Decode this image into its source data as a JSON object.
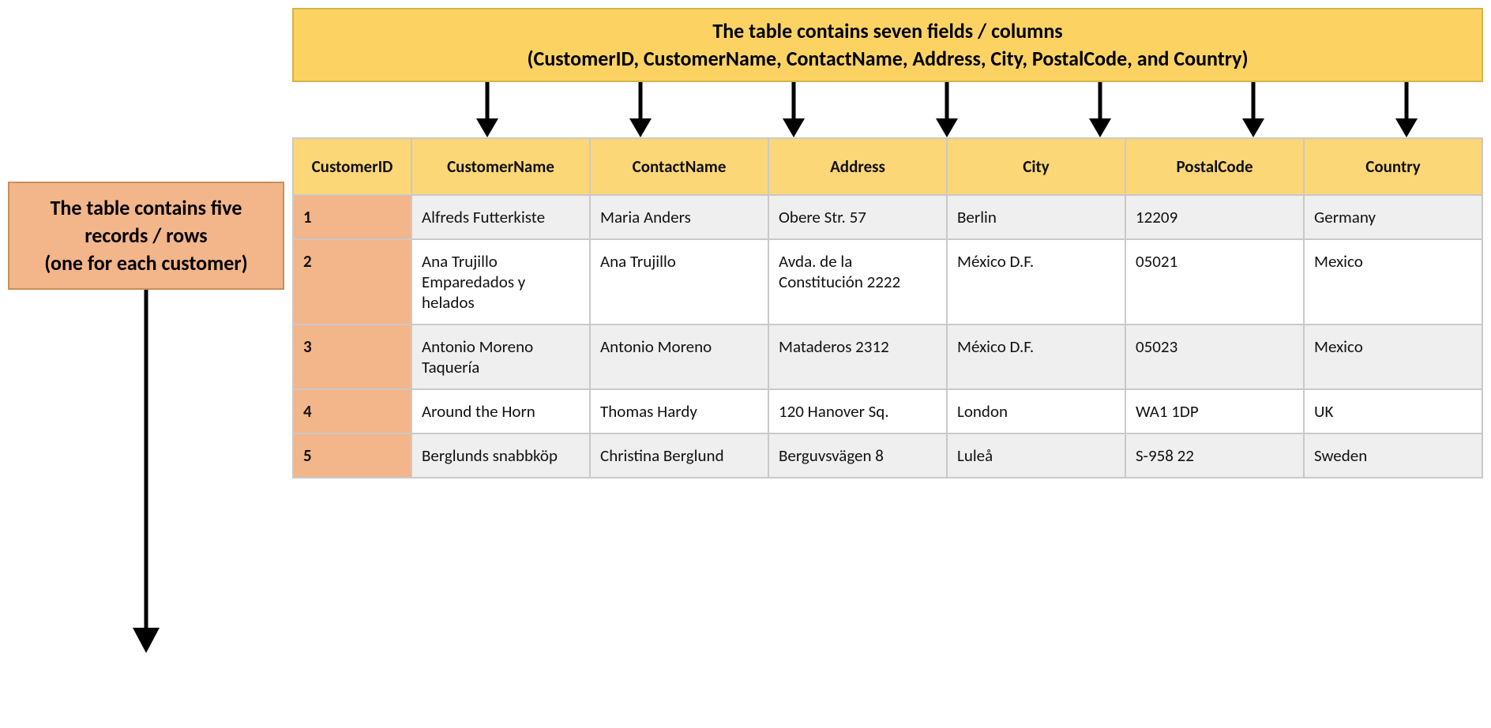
{
  "callouts": {
    "columns_line1": "The table contains seven fields / columns",
    "columns_line2": "(CustomerID, CustomerName, ContactName, Address, City, PostalCode, and Country)",
    "rows_line1": "The table contains five",
    "rows_line2": "records / rows",
    "rows_line3": "(one for each customer)"
  },
  "table": {
    "columns": [
      "CustomerID",
      "CustomerName",
      "ContactName",
      "Address",
      "City",
      "PostalCode",
      "Country"
    ],
    "rows": [
      {
        "CustomerID": "1",
        "CustomerName": "Alfreds Futterkiste",
        "ContactName": "Maria Anders",
        "Address": "Obere Str. 57",
        "City": "Berlin",
        "PostalCode": "12209",
        "Country": "Germany"
      },
      {
        "CustomerID": "2",
        "CustomerName": "Ana Trujillo Emparedados y helados",
        "ContactName": "Ana Trujillo",
        "Address": "Avda. de la Constitución 2222",
        "City": "México D.F.",
        "PostalCode": "05021",
        "Country": "Mexico"
      },
      {
        "CustomerID": "3",
        "CustomerName": "Antonio Moreno Taquería",
        "ContactName": "Antonio Moreno",
        "Address": "Mataderos 2312",
        "City": "México D.F.",
        "PostalCode": "05023",
        "Country": "Mexico"
      },
      {
        "CustomerID": "4",
        "CustomerName": "Around the Horn",
        "ContactName": "Thomas Hardy",
        "Address": "120 Hanover Sq.",
        "City": "London",
        "PostalCode": "WA1 1DP",
        "Country": "UK"
      },
      {
        "CustomerID": "5",
        "CustomerName": "Berglunds snabbköp",
        "ContactName": "Christina Berglund",
        "Address": "Berguvsvägen 8",
        "City": "Luleå",
        "PostalCode": "S-958 22",
        "Country": "Sweden"
      }
    ]
  },
  "chart_data": {
    "type": "table",
    "title": "",
    "columns": [
      "CustomerID",
      "CustomerName",
      "ContactName",
      "Address",
      "City",
      "PostalCode",
      "Country"
    ],
    "data": [
      [
        "1",
        "Alfreds Futterkiste",
        "Maria Anders",
        "Obere Str. 57",
        "Berlin",
        "12209",
        "Germany"
      ],
      [
        "2",
        "Ana Trujillo Emparedados y helados",
        "Ana Trujillo",
        "Avda. de la Constitución 2222",
        "México D.F.",
        "05021",
        "Mexico"
      ],
      [
        "3",
        "Antonio Moreno Taquería",
        "Antonio Moreno",
        "Mataderos 2312",
        "México D.F.",
        "05023",
        "Mexico"
      ],
      [
        "4",
        "Around the Horn",
        "Thomas Hardy",
        "120 Hanover Sq.",
        "London",
        "WA1 1DP",
        "UK"
      ],
      [
        "5",
        "Berglunds snabbköp",
        "Christina Berglund",
        "Berguvsvägen 8",
        "Luleå",
        "S-958 22",
        "Sweden"
      ]
    ],
    "annotations": [
      "The table contains seven fields / columns (CustomerID, CustomerName, ContactName, Address, City, PostalCode, and Country)",
      "The table contains five records / rows (one for each customer)"
    ]
  }
}
